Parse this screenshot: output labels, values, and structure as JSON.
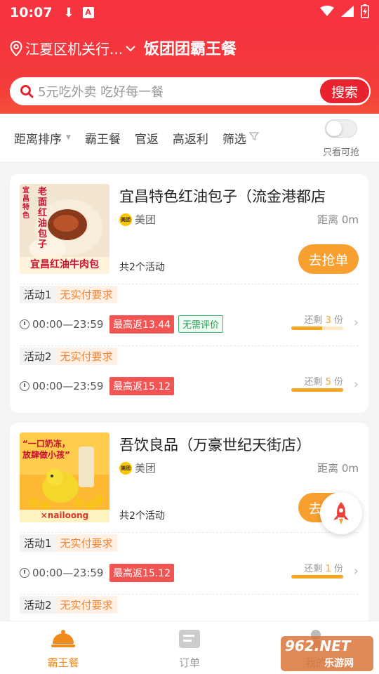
{
  "status_bar": {
    "time": "10:07"
  },
  "header": {
    "location": "江夏区机关行...",
    "app_title": "饭团团霸王餐",
    "search_placeholder": "5元吃外卖 吃好每一餐",
    "search_button": "搜索"
  },
  "filters": {
    "items": [
      "距离排序",
      "霸王餐",
      "官返",
      "高返利",
      "筛选"
    ],
    "toggle_label": "只看可抢",
    "toggle_on": false
  },
  "shops": [
    {
      "name": "宜昌特色红油包子（流金港都店",
      "platform": "美团",
      "distance": "距离 0m",
      "activity_count": "共2个活动",
      "grab_label": "去抢单",
      "thumb_text_top": "老面红油包子",
      "thumb_text_side": "宜昌特色",
      "thumb_text_bottom": "宜昌红油牛肉包",
      "activities": [
        {
          "label": "活动1",
          "requirement": "无实付要求",
          "time": "00:00—23:59",
          "rebate": "最高返13.44",
          "extra_tag": "无需评价",
          "remain_prefix": "还剩",
          "remain_count": "3",
          "remain_suffix": "份",
          "remain_fraction": 0.6
        },
        {
          "label": "活动2",
          "requirement": "无实付要求",
          "time": "00:00—23:59",
          "rebate": "最高返15.12",
          "extra_tag": "",
          "remain_prefix": "还剩",
          "remain_count": "5",
          "remain_suffix": "份",
          "remain_fraction": 1.0
        }
      ]
    },
    {
      "name": "吾饮良品（万豪世纪天街店）",
      "platform": "美团",
      "distance": "距离 0m",
      "activity_count": "共2个活动",
      "grab_label": "去抢单",
      "thumb_text_top": "“一口奶冻，放肆做小孩”",
      "thumb_text_bottom": "×nailoong",
      "activities": [
        {
          "label": "活动1",
          "requirement": "无实付要求",
          "time": "00:00—23:59",
          "rebate": "最高返15.12",
          "extra_tag": "",
          "remain_prefix": "还剩",
          "remain_count": "1",
          "remain_suffix": "份",
          "remain_fraction": 1.0
        },
        {
          "label": "活动2",
          "requirement": "无实付要求"
        }
      ]
    }
  ],
  "tabs": [
    {
      "label": "霸王餐",
      "active": true
    },
    {
      "label": "订单",
      "active": false
    },
    {
      "label": "我的",
      "active": false
    }
  ],
  "watermark": {
    "text_top": "962.NET",
    "text_bottom": "乐游网"
  },
  "colors": {
    "brand_red": "#f5343f",
    "accent_orange": "#f8a02f",
    "rebate_red": "#f25454"
  }
}
